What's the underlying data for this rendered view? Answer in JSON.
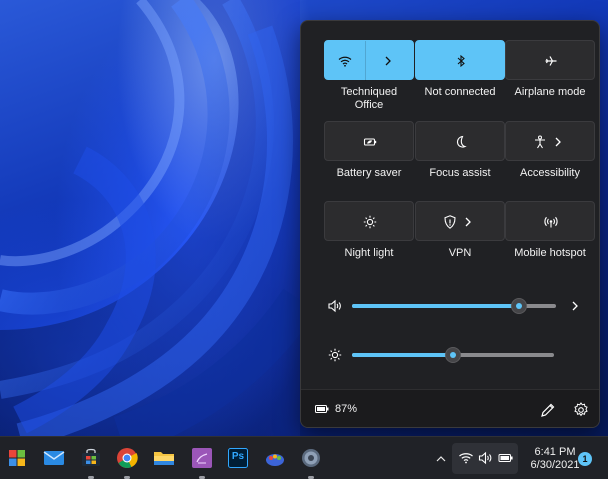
{
  "quick_settings": {
    "tiles": [
      {
        "id": "wifi",
        "label": "Techniqued\nOffice",
        "icon": "wifi-icon",
        "active": true,
        "has_chevron": true
      },
      {
        "id": "bluetooth",
        "label": "Not connected",
        "icon": "bluetooth-icon",
        "active": true,
        "has_chevron": false
      },
      {
        "id": "airplane",
        "label": "Airplane mode",
        "icon": "airplane-icon",
        "active": false,
        "has_chevron": false
      },
      {
        "id": "battery-saver",
        "label": "Battery saver",
        "icon": "battery-saver-icon",
        "active": false,
        "has_chevron": false
      },
      {
        "id": "focus-assist",
        "label": "Focus assist",
        "icon": "moon-icon",
        "active": false,
        "has_chevron": false
      },
      {
        "id": "accessibility",
        "label": "Accessibility",
        "icon": "accessibility-icon",
        "active": false,
        "has_chevron": true
      },
      {
        "id": "night-light",
        "label": "Night light",
        "icon": "sun-icon",
        "active": false,
        "has_chevron": false
      },
      {
        "id": "vpn",
        "label": "VPN",
        "icon": "shield-icon",
        "active": false,
        "has_chevron": true
      },
      {
        "id": "mobile-hotspot",
        "label": "Mobile hotspot",
        "icon": "hotspot-icon",
        "active": false,
        "has_chevron": false
      }
    ],
    "volume": {
      "icon": "speaker-icon",
      "level": 0.82
    },
    "brightness": {
      "icon": "brightness-icon",
      "level": 0.5
    },
    "battery_percent": "87%",
    "accent_color": "#5ec4f7"
  },
  "taskbar": {
    "apps": [
      {
        "name": "start-button",
        "icon": "windows-logo-icon",
        "running": false
      },
      {
        "name": "mail-app",
        "icon": "mail-icon",
        "running": false
      },
      {
        "name": "store-app",
        "icon": "store-icon",
        "running": true
      },
      {
        "name": "chrome-app",
        "icon": "chrome-icon",
        "running": true
      },
      {
        "name": "file-explorer-app",
        "icon": "folder-icon",
        "running": false
      },
      {
        "name": "onenote-app",
        "icon": "notebook-icon",
        "running": true
      },
      {
        "name": "photoshop-app",
        "icon": "photoshop-icon",
        "running": false,
        "text": "Ps"
      },
      {
        "name": "paint-app",
        "icon": "paint-icon",
        "running": false
      },
      {
        "name": "settings-app",
        "icon": "gear-icon",
        "running": true
      }
    ],
    "clock": {
      "time": "6:41 PM",
      "date": "6/30/2021"
    },
    "notifications_count": "1"
  }
}
